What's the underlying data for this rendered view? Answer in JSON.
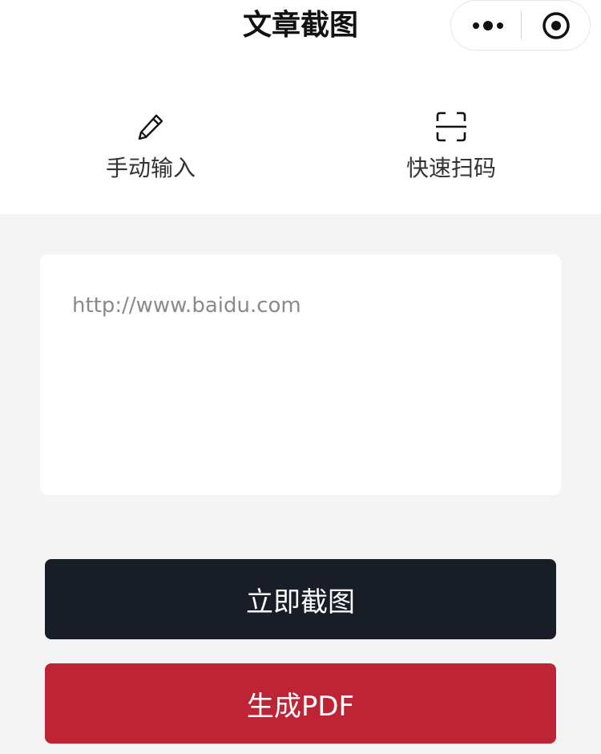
{
  "header": {
    "title": "文章截图"
  },
  "capsule": {
    "more_icon": "more-dots-icon",
    "close_icon": "target-icon"
  },
  "tools": [
    {
      "label": "手动输入",
      "icon": "pencil-icon"
    },
    {
      "label": "快速扫码",
      "icon": "scan-icon"
    }
  ],
  "url_input": {
    "placeholder": "http://www.baidu.com",
    "value": ""
  },
  "buttons": {
    "screenshot": "立即截图",
    "pdf": "生成PDF"
  },
  "colors": {
    "screenshot_button": "#181d27",
    "pdf_button": "#bd2537",
    "background": "#f4f4f4"
  }
}
